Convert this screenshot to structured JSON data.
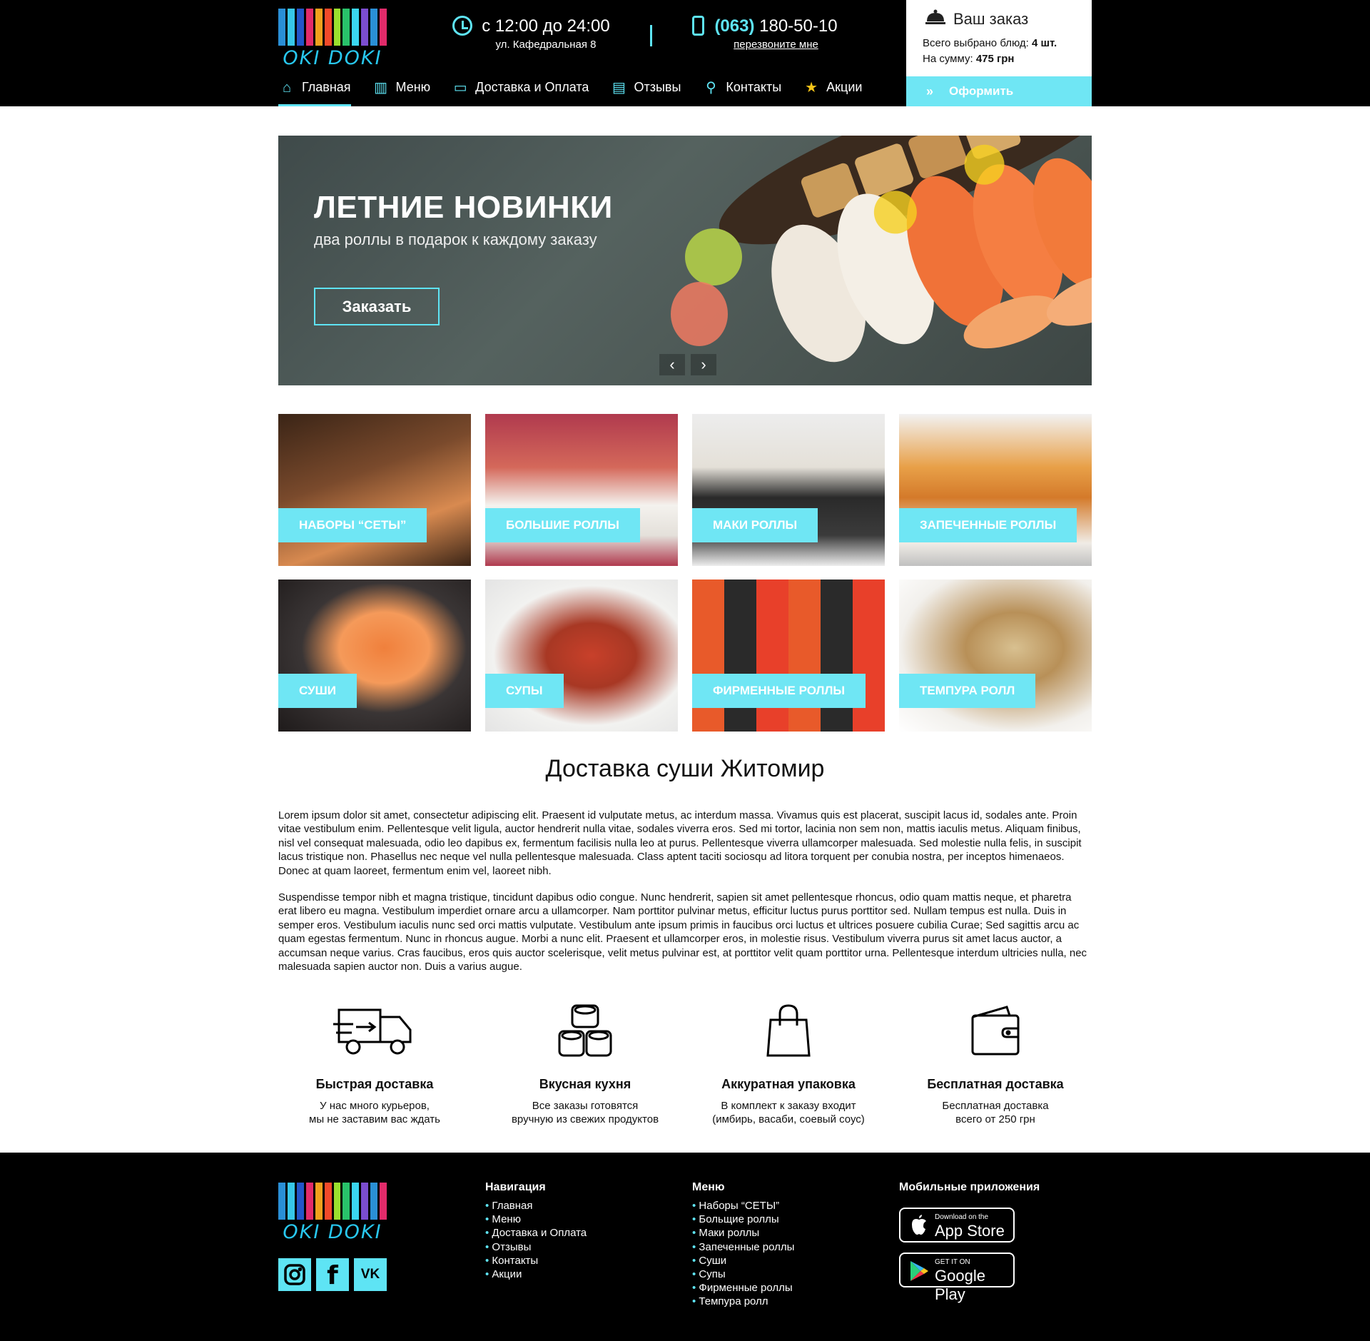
{
  "brand": {
    "logo_text": "OKI DOKI",
    "accent_color": "#5ee4f4",
    "button_color": "#6fe6f4"
  },
  "header": {
    "hours": "с 12:00 до 24:00",
    "address": "ул. Кафедральная 8",
    "phone_code": "(063)",
    "phone_number": "180-50-10",
    "callback": "перезвоните мне"
  },
  "cart": {
    "title": "Ваш заказ",
    "items_label": "Всего выбрано блюд:",
    "items_value": "4 шт.",
    "sum_label": "На сумму:",
    "sum_value": "475 грн",
    "checkout": "Оформить"
  },
  "nav": [
    {
      "label": "Главная",
      "icon": "home-icon",
      "active": true
    },
    {
      "label": "Меню",
      "icon": "book-icon"
    },
    {
      "label": "Доставка и Оплата",
      "icon": "card-icon"
    },
    {
      "label": "Отзывы",
      "icon": "message-icon"
    },
    {
      "label": "Контакты",
      "icon": "pin-icon"
    },
    {
      "label": "Акции",
      "icon": "star-icon"
    }
  ],
  "hero": {
    "title": "ЛЕТНИЕ НОВИНКИ",
    "subtitle": "два роллы в подарок к каждому заказу",
    "button": "Заказать",
    "prev_icon": "chevron-left-icon",
    "next_icon": "chevron-right-icon"
  },
  "categories": [
    {
      "label": "НАБОРЫ “СЕТЫ”"
    },
    {
      "label": "БОЛЬШИЕ РОЛЛЫ"
    },
    {
      "label": "МАКИ РОЛЛЫ"
    },
    {
      "label": "ЗАПЕЧЕННЫЕ РОЛЛЫ"
    },
    {
      "label": "СУШИ"
    },
    {
      "label": "СУПЫ"
    },
    {
      "label": "ФИРМЕННЫЕ РОЛЛЫ"
    },
    {
      "label": "ТЕМПУРА РОЛЛ"
    }
  ],
  "about": {
    "title": "Доставка суши Житомир",
    "p1": "Lorem ipsum dolor sit amet, consectetur adipiscing elit. Praesent id vulputate metus, ac interdum massa. Vivamus quis est placerat, suscipit lacus id, sodales ante. Proin vitae vestibulum enim. Pellentesque velit ligula, auctor hendrerit nulla vitae, sodales viverra eros. Sed mi tortor, lacinia non sem non, mattis iaculis metus. Aliquam finibus, nisl vel consequat malesuada, odio leo dapibus ex, fermentum facilisis nulla leo at purus. Pellentesque viverra ullamcorper malesuada. Sed molestie nulla felis, in suscipit lacus tristique non. Phasellus nec neque vel nulla pellentesque malesuada. Class aptent taciti sociosqu ad litora torquent per conubia nostra, per inceptos himenaeos. Donec at quam laoreet, fermentum enim vel, laoreet nibh.",
    "p2": "Suspendisse tempor nibh et magna tristique, tincidunt dapibus odio congue. Nunc hendrerit, sapien sit amet pellentesque rhoncus, odio quam mattis neque, et pharetra erat libero eu magna. Vestibulum imperdiet ornare arcu a ullamcorper. Nam porttitor pulvinar metus, efficitur luctus purus porttitor sed. Nullam tempus est nulla. Duis in semper eros. Vestibulum iaculis nunc sed orci mattis vulputate. Vestibulum ante ipsum primis in faucibus orci luctus et ultrices posuere cubilia Curae; Sed sagittis arcu ac quam egestas fermentum. Nunc in rhoncus augue. Morbi a nunc elit. Praesent et ullamcorper eros, in molestie risus. Vestibulum viverra purus sit amet lacus auctor, a accumsan neque varius. Cras faucibus, eros quis auctor scelerisque, velit metus pulvinar est, at porttitor velit quam porttitor urna. Pellentesque interdum ultricies nulla, nec malesuada sapien auctor non. Duis a varius augue."
  },
  "features": [
    {
      "icon": "truck-icon",
      "title": "Быстрая доставка",
      "line1": "У нас много курьеров,",
      "line2": "мы не заставим вас ждать"
    },
    {
      "icon": "rolls-icon",
      "title": "Вкусная кухня",
      "line1": "Все заказы готовятся",
      "line2": "вручную из свежих продуктов"
    },
    {
      "icon": "bag-icon",
      "title": "Аккуратная упаковка",
      "line1": "В комплект к заказу входит",
      "line2": "(имбирь, васаби, соевый соус)"
    },
    {
      "icon": "wallet-icon",
      "title": "Бесплатная доставка",
      "line1": "Бесплатная доставка",
      "line2": "всего от 250 грн"
    }
  ],
  "footer": {
    "nav_title": "Навигация",
    "nav_items": [
      "Главная",
      "Меню",
      "Доставка и Оплата",
      "Отзывы",
      "Контакты",
      "Акции"
    ],
    "menu_title": "Меню",
    "menu_items": [
      "Наборы “СЕТЫ”",
      "Больщие роллы",
      "Маки роллы",
      "Запеченные роллы",
      "Суши",
      "Супы",
      "Фирменные роллы",
      "Темпура ролл"
    ],
    "apps_title": "Мобильные приложения",
    "appstore_small": "Download on the",
    "appstore_big": "App Store",
    "gplay_small": "GET IT ON",
    "gplay_big": "Google Play",
    "social": [
      "instagram-icon",
      "facebook-icon",
      "vk-icon"
    ],
    "social_text": {
      "fb": "f",
      "vk": "VK"
    }
  }
}
